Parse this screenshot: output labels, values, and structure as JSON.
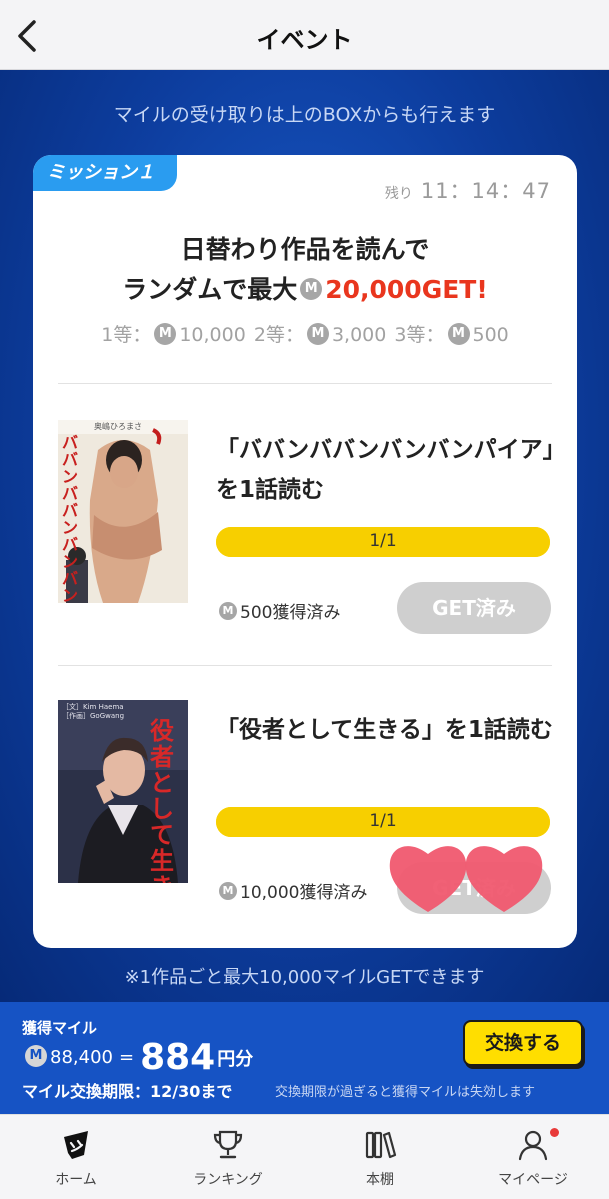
{
  "header": {
    "title": "イベント",
    "back_icon": "chevron-left-icon"
  },
  "notice_top": "マイルの受け取りは上のBOXからも行えます",
  "mission": {
    "badge": "ミッション１",
    "timer_label": "残り",
    "timer_value": "11：14：47",
    "headline_line1": "日替わり作品を読んで",
    "headline_line2_prefix": "ランダムで最大",
    "headline_amount": "20,000GET!",
    "coin_letter": "M",
    "prizes": [
      {
        "rank": "1等：",
        "amount": "10,000"
      },
      {
        "rank": "2等：",
        "amount": "3,000"
      },
      {
        "rank": "3等：",
        "amount": "500"
      }
    ],
    "tasks": [
      {
        "title": "「ババンババンバンバンパイア」を1話読む",
        "progress_text": "1/1",
        "progress": 1.0,
        "reward": "500獲得済み",
        "button": "GET済み",
        "cover_title": "ババンババンバンバンパイア",
        "cover_author": "奥嶋ひろまさ"
      },
      {
        "title": "「役者として生きる」を1話読む",
        "progress_text": "1/1",
        "progress": 1.0,
        "reward": "10,000獲得済み",
        "button": "GET済み",
        "cover_title": "役者として生きる",
        "cover_credit1": "［文］Kim Haema",
        "cover_credit2": "［作画］GoGwang"
      }
    ]
  },
  "notice_bottom": "※1作品ごと最大10,000マイルGETできます",
  "miles": {
    "label": "獲得マイル",
    "amount": "88,400",
    "equals": "=",
    "yen_value": "884",
    "yen_unit": "円分",
    "exchange_button": "交換する",
    "expiry": "マイル交換期限：12/30まで",
    "expiry_note": "交換期限が過ぎると獲得マイルは失効します"
  },
  "tabs": [
    {
      "label": "ホーム",
      "icon": "home-icon"
    },
    {
      "label": "ランキング",
      "icon": "trophy-icon"
    },
    {
      "label": "本棚",
      "icon": "bookshelf-icon"
    },
    {
      "label": "マイページ",
      "icon": "user-icon"
    }
  ],
  "colors": {
    "accent_blue": "#1653c4",
    "mission_badge": "#2a9cf0",
    "highlight_red": "#e9361e",
    "progress_yellow": "#ffd400",
    "exchange_yellow": "#ffde00",
    "heart_pink": "#f0586f"
  }
}
